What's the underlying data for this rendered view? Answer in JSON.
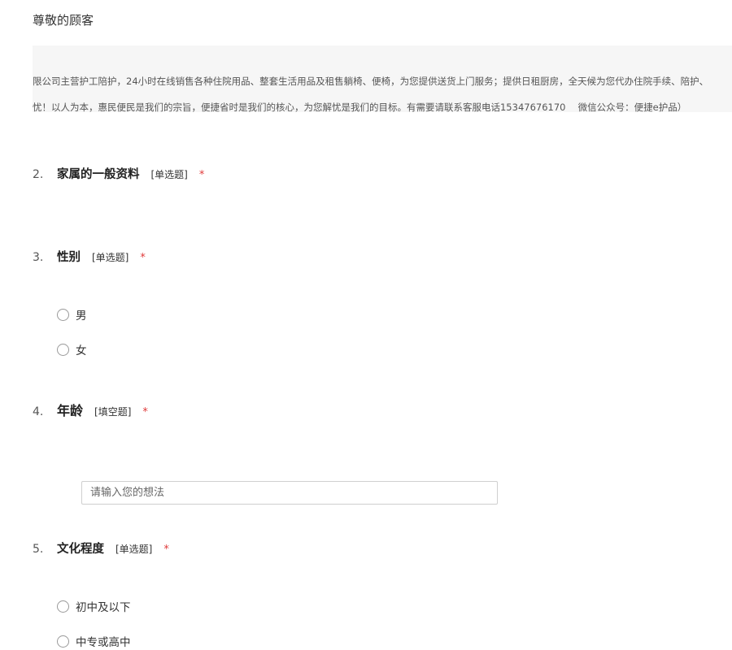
{
  "greeting": "尊敬的顾客",
  "intro": {
    "line1": "限公司主营护工陪护，24小时在线销售各种住院用品、整套生活用品及租售躺椅、便椅，为您提供送货上门服务；提供日租厨房，全天候为您代办住院手续、陪护、",
    "line2": "忧！以人为本，惠民便民是我们的宗旨，便捷省时是我们的核心，为您解忧是我们的目标。有需要请联系客服电话15347676170　 微信公众号：便捷e护品）"
  },
  "questions": [
    {
      "num": "2.",
      "title": "家属的一般资料",
      "type": "[单选题]",
      "required": "*"
    },
    {
      "num": "3.",
      "title": "性别",
      "type": "[单选题]",
      "required": "*",
      "options": [
        "男",
        "女"
      ]
    },
    {
      "num": "4.",
      "title": "年龄",
      "type": "[填空题]",
      "required": "*",
      "input": {
        "placeholder": "请输入您的想法",
        "value": ""
      }
    },
    {
      "num": "5.",
      "title": "文化程度",
      "type": "[单选题]",
      "required": "*",
      "options": [
        "初中及以下",
        "中专或高中"
      ]
    }
  ],
  "colors": {
    "required": "#e03a3a",
    "intro_bg": "#f6f6f6"
  },
  "icons": {
    "radio": "radio-unchecked-icon"
  }
}
